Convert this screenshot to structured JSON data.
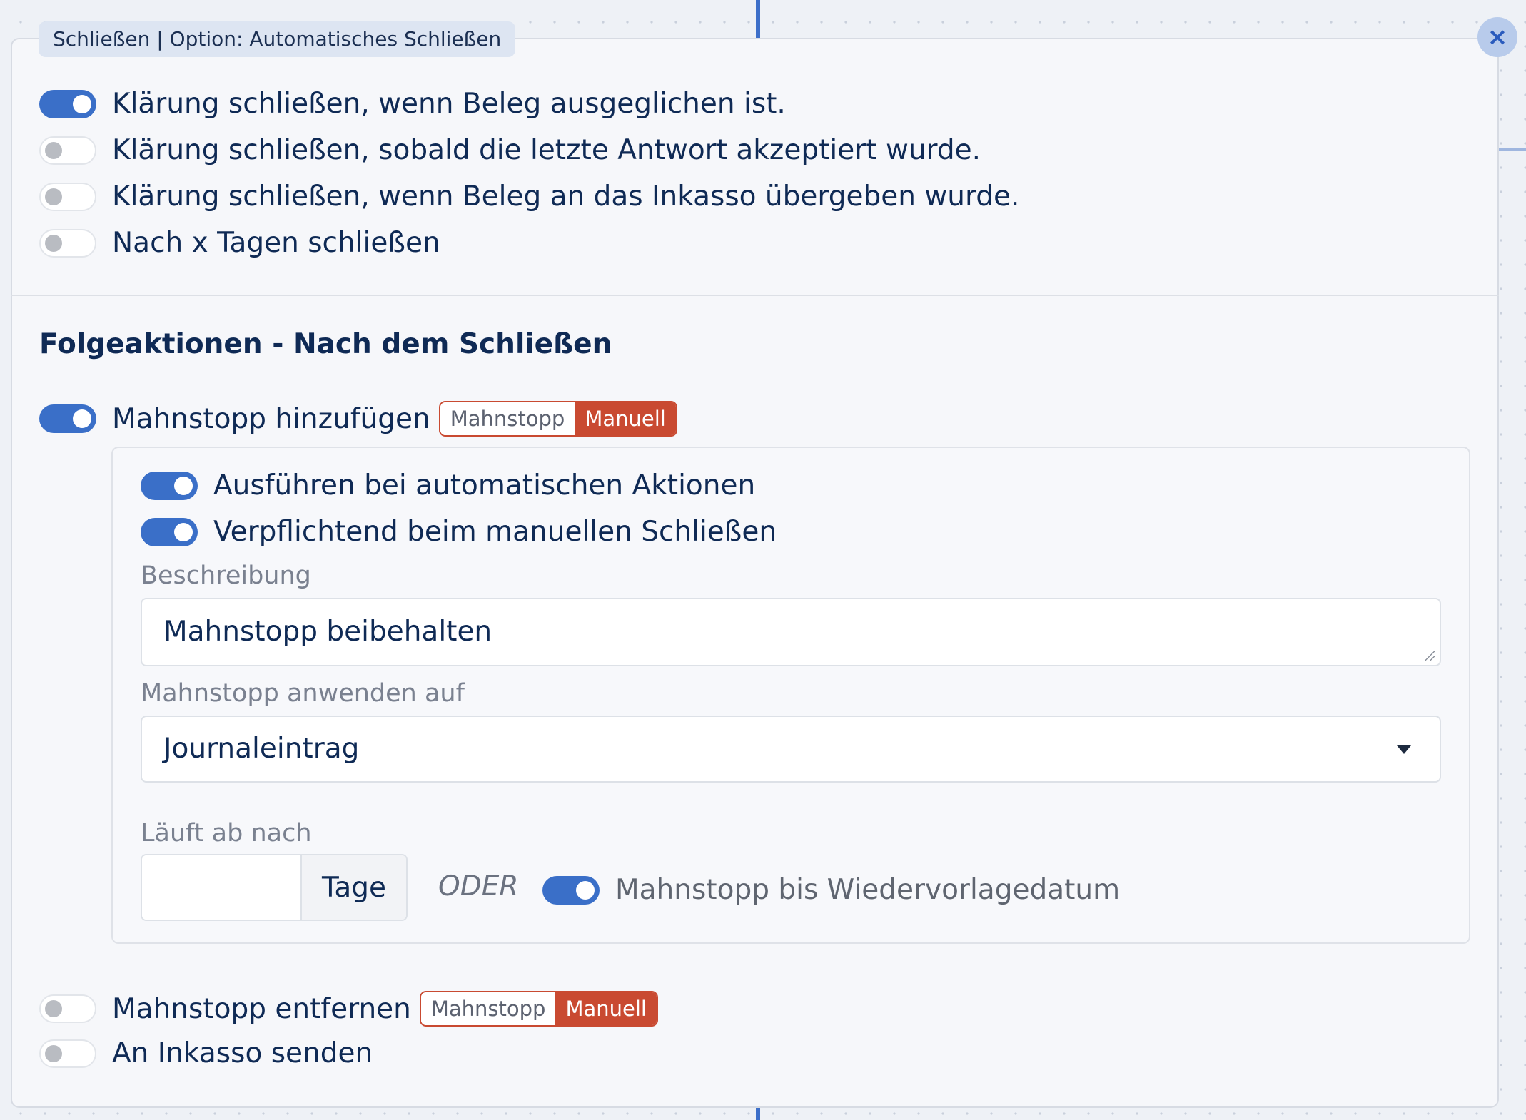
{
  "panel": {
    "tag": "Schließen | Option: Automatisches Schließen",
    "close_icon": "×"
  },
  "auto_close_options": [
    {
      "label": "Klärung schließen, wenn Beleg ausgeglichen ist.",
      "on": true
    },
    {
      "label": "Klärung schließen, sobald die letzte Antwort akzeptiert wurde.",
      "on": false
    },
    {
      "label": "Klärung schließen, wenn Beleg an das Inkasso übergeben wurde.",
      "on": false
    },
    {
      "label": "Nach x Tagen schließen",
      "on": false
    }
  ],
  "followup": {
    "title": "Folgeaktionen - Nach dem Schließen",
    "add_stop": {
      "label": "Mahnstopp hinzufügen",
      "on": true,
      "badge_left": "Mahnstopp",
      "badge_right": "Manuell"
    },
    "details": {
      "auto_actions": {
        "label": "Ausführen bei automatischen Aktionen",
        "on": true
      },
      "mandatory_manual": {
        "label": "Verpflichtend beim manuellen Schließen",
        "on": true
      },
      "description_label": "Beschreibung",
      "description_value": "Mahnstopp beibehalten",
      "apply_label": "Mahnstopp anwenden auf",
      "apply_value": "Journaleintrag",
      "expires_label": "Läuft ab nach",
      "days_value": "",
      "days_unit": "Tage",
      "or_text": "ODER",
      "until_resubmission": {
        "label": "Mahnstopp bis Wiedervorlagedatum",
        "on": true
      }
    },
    "remove_stop": {
      "label": "Mahnstopp entfernen",
      "on": false,
      "badge_left": "Mahnstopp",
      "badge_right": "Manuell"
    },
    "send_collection": {
      "label": "An Inkasso senden",
      "on": false
    }
  },
  "colors": {
    "accent": "#3a6fc8",
    "badge_red": "#c94a31",
    "text": "#0f2a55",
    "muted": "#7a8190"
  }
}
